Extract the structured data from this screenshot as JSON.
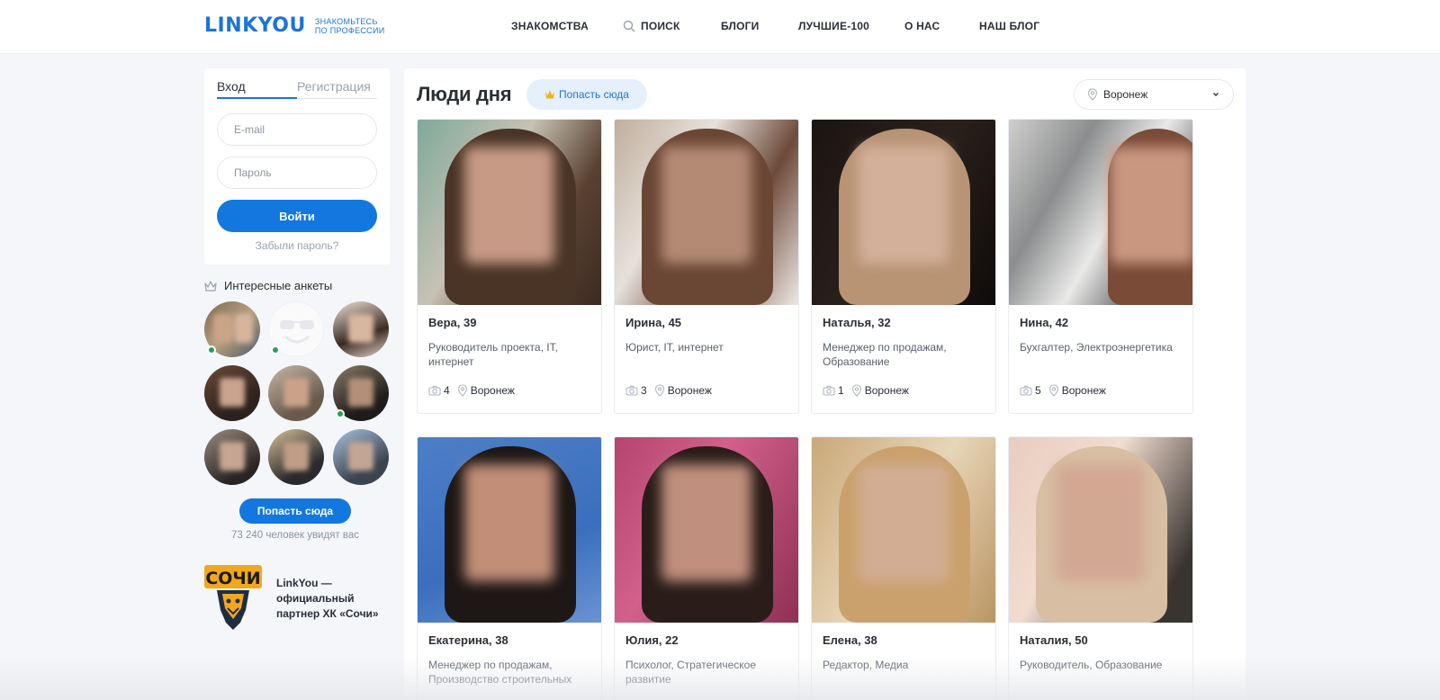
{
  "header": {
    "logo_word": "LINKYOU",
    "logo_tagline_1": "ЗНАКОМЬТЕСЬ",
    "logo_tagline_2": "ПО ПРОФЕССИИ",
    "nav": [
      "ЗНАКОМСТВА",
      "ПОИСК",
      "БЛОГИ",
      "ЛУЧШИЕ-100",
      "О НАС",
      "НАШ БЛОГ"
    ]
  },
  "login": {
    "tab_login": "Вход",
    "tab_register": "Регистрация",
    "email_placeholder": "E-mail",
    "password_placeholder": "Пароль",
    "submit_label": "Войти",
    "forgot_label": "Забыли пароль?"
  },
  "interesting": {
    "title": "Интересные анкеты",
    "avatars": [
      {
        "online": true
      },
      {
        "online": true
      },
      {
        "online": false
      },
      {
        "online": false
      },
      {
        "online": false
      },
      {
        "online": true
      },
      {
        "online": false
      },
      {
        "online": false
      },
      {
        "online": false
      }
    ],
    "button_label": "Попасть сюда",
    "viewers_text": "73 240 человек увидят вас"
  },
  "partner": {
    "logo_text": "СОЧИ",
    "text": "LinkYou — официальный партнер ХК «Сочи»"
  },
  "main": {
    "title": "Люди дня",
    "get_here_label": "Попасть сюда",
    "city_select": "Воронеж",
    "people": [
      {
        "name": "Вера, 39",
        "profession": "Руководитель проекта, IT, интернет",
        "photos": "4",
        "city": "Воронеж"
      },
      {
        "name": "Ирина, 45",
        "profession": "Юрист, IT, интернет",
        "photos": "3",
        "city": "Воронеж"
      },
      {
        "name": "Наталья, 32",
        "profession": "Менеджер по продажам, Образование",
        "photos": "1",
        "city": "Воронеж"
      },
      {
        "name": "Нина, 42",
        "profession": "Бухгалтер, Электроэнергетика",
        "photos": "5",
        "city": "Воронеж"
      },
      {
        "name": "Екатерина, 38",
        "profession": "Менеджер по продажам, Производство строительных материалов",
        "photos": "",
        "city": ""
      },
      {
        "name": "Юлия, 22",
        "profession": "Психолог, Стратегическое развитие",
        "photos": "",
        "city": ""
      },
      {
        "name": "Елена, 38",
        "profession": "Редактор, Медиа",
        "photos": "",
        "city": ""
      },
      {
        "name": "Наталия, 50",
        "profession": "Руководитель, Образование",
        "photos": "",
        "city": ""
      }
    ]
  },
  "colors": {
    "brand": "#1b74d8",
    "button": "#1377e0",
    "online": "#1fa35c",
    "page_bg": "#f4f6fa"
  },
  "icons": [
    "search-icon",
    "crown-icon",
    "location-pin-icon",
    "chevron-down-icon",
    "camera-icon"
  ]
}
